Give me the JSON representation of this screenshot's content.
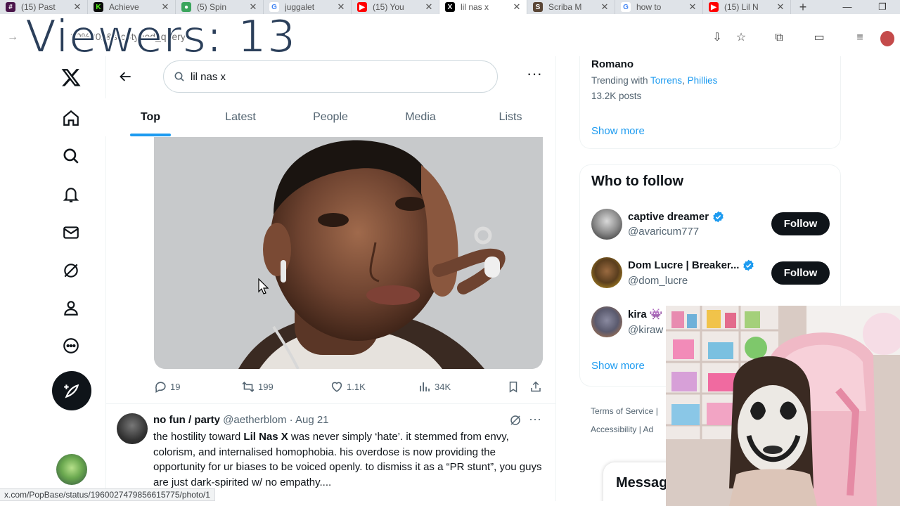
{
  "browser": {
    "tabs": [
      {
        "title": "(15) Past",
        "favicon": "slack-icon",
        "color": "#4a154b"
      },
      {
        "title": "Achieve",
        "favicon": "kick-icon",
        "color": "#53fc18"
      },
      {
        "title": "(5) Spin",
        "favicon": "discord-icon",
        "color": "#3ba55d"
      },
      {
        "title": "juggalet",
        "favicon": "google-icon",
        "color": "#4285f4"
      },
      {
        "title": "(15) You",
        "favicon": "youtube-icon",
        "color": "#ff0000"
      },
      {
        "title": "lil nas x",
        "favicon": "x-icon",
        "color": "#000000",
        "active": true
      },
      {
        "title": "Scriba M",
        "favicon": "scriba-icon",
        "color": "#5a4636"
      },
      {
        "title": "how to",
        "favicon": "google-icon",
        "color": "#4285f4"
      },
      {
        "title": "(15) Lil N",
        "favicon": "youtube-icon",
        "color": "#ff0000"
      }
    ],
    "url_text": "20%20x&src=typed_query",
    "status_url": "x.com/PopBase/status/1960027479856615775/photo/1"
  },
  "overlay": {
    "viewers_label": "Viewers: 13"
  },
  "search": {
    "query": "lil nas x"
  },
  "search_tabs": [
    {
      "label": "Top",
      "active": true
    },
    {
      "label": "Latest"
    },
    {
      "label": "People"
    },
    {
      "label": "Media"
    },
    {
      "label": "Lists"
    }
  ],
  "post1": {
    "replies": "19",
    "reposts": "199",
    "likes": "1.1K",
    "views": "34K"
  },
  "post2": {
    "name": "no fun / party",
    "handle": "@aetherblom",
    "date": "Aug 21",
    "text_before": "the hostility toward ",
    "text_bold": "Lil Nas X",
    "text_after": " was never simply ‘hate’. it stemmed from envy, colorism, and internalised homophobia. his overdose is now providing the opportunity for ur biases to be voiced openly. to dismiss it as a “PR stunt”, you guys are just dark-spirited w/ no empathy...."
  },
  "trending": {
    "title": "Romano",
    "prefix": "Trending with ",
    "link1": "Torrens",
    "sep": ", ",
    "link2": "Phillies",
    "count": "13.2K posts",
    "show_more": "Show more"
  },
  "who_to_follow": {
    "title": "Who to follow",
    "follow_label": "Follow",
    "users": [
      {
        "name": "captive dreamer",
        "handle": "@avaricum777",
        "verified": true
      },
      {
        "name": "Dom Lucre | Breaker...",
        "handle": "@dom_lucre",
        "verified": true
      },
      {
        "name": "kira 👾",
        "handle": "@kiraw"
      }
    ],
    "show_more": "Show more"
  },
  "footer": {
    "terms": "Terms of Service",
    "accessibility": "Accessibility",
    "ad": "Ad"
  },
  "messages": {
    "label": "Messag"
  },
  "colors": {
    "accent": "#1d9bf0",
    "text": "#0f1419",
    "secondary": "#536471",
    "verified": "#1d9bf0"
  }
}
